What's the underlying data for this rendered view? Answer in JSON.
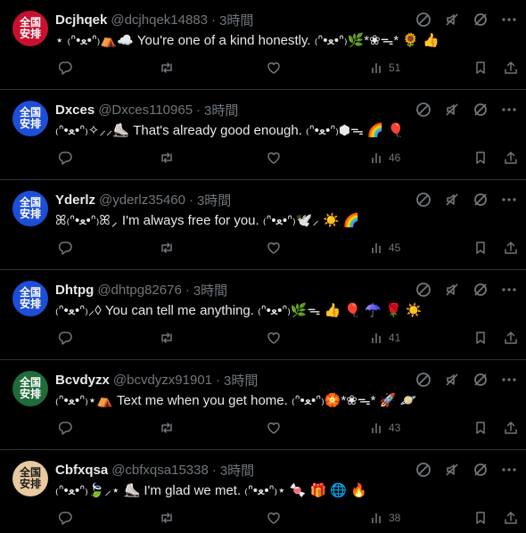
{
  "icons": {
    "header": [
      "block-icon",
      "mute-icon",
      "hide-icon",
      "more-icon"
    ],
    "actions": [
      "reply-icon",
      "retweet-icon",
      "like-icon",
      "views-icon",
      "bookmark-icon",
      "share-icon"
    ]
  },
  "colors": {
    "background": "#000000",
    "divider": "#2f3336",
    "muted": "#71767b",
    "text": "#e7e9ea"
  },
  "tweets": [
    {
      "avatar_text": "全国安排",
      "avatar_bg": "#c8102e",
      "name": "Dcjhqek",
      "handle": "@dcjhqek14883",
      "time": "3時間",
      "text": "⋆ ₍ᐢ•ﻌ•ᐢ₎⛺☁️ You're one of a kind honestly. ₍ᐢ•ﻌ•ᐢ₎🌿*❀ᯓ* 🌻 👍",
      "views": "51"
    },
    {
      "avatar_text": "全国安排",
      "avatar_bg": "#1d4ed8",
      "name": "Dxces",
      "handle": "@Dxces110965",
      "time": "3時間",
      "text": "₍ᐢ•ﻌ•ᐢ₎✧⸝⸝⛸️ That's already good enough. ₍ᐢ•ﻌ•ᐢ₎⬢ᯓ 🌈 🎈",
      "views": "46"
    },
    {
      "avatar_text": "全国安排",
      "avatar_bg": "#1d4ed8",
      "name": "Yderlz",
      "handle": "@yderlz35460",
      "time": "3時間",
      "text": "ꕤ₍ᐢ•ﻌ•ᐢ₎ꕤ⸝ I'm always free for you. ₍ᐢ•ﻌ•ᐢ₎🕊️⸝ ☀️ 🌈",
      "views": "45"
    },
    {
      "avatar_text": "全国安排",
      "avatar_bg": "#1d4ed8",
      "name": "Dhtpg",
      "handle": "@dhtpg82676",
      "time": "3時間",
      "text": "₍ᐢ•ﻌ•ᐢ₎⸝◊ You can tell me anything. ₍ᐢ•ﻌ•ᐢ₎🌿ᯓ 👍 🎈 ☂️ 🌹 ☀️",
      "views": "41"
    },
    {
      "avatar_text": "全国安排",
      "avatar_bg": "#1f6b3a",
      "name": "Bcvdyzx",
      "handle": "@bcvdyzx91901",
      "time": "3時間",
      "text": "₍ᐢ•ﻌ•ᐢ₎⋆⛺ Text me when you get home. ₍ᐢ•ﻌ•ᐢ₎🏵️*❀ᯓ* 🚀 🪐",
      "views": "43"
    },
    {
      "avatar_text": "全国安排",
      "avatar_bg": "#e8c9a0",
      "avatar_fg": "#1a1a1a",
      "name": "Cbfxqsa",
      "handle": "@cbfxqsa15338",
      "time": "3時間",
      "text": "₍ᐢ•ﻌ•ᐢ₎🍃⸝⋆ ⛸️ I'm glad we met. ₍ᐢ•ﻌ•ᐢ₎⋆ 🍬 🎁 🌐 🔥",
      "views": "38"
    }
  ]
}
